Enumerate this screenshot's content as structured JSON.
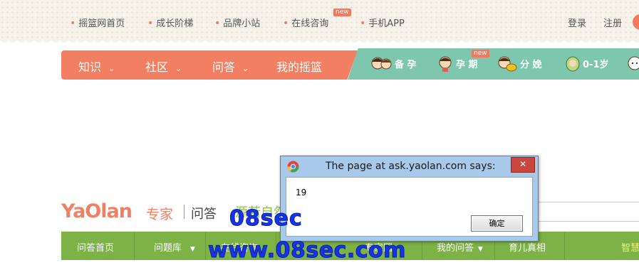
{
  "topbar": {
    "links": [
      {
        "label": "摇篮网首页",
        "name": "home"
      },
      {
        "label": "成长阶梯",
        "name": "growth"
      },
      {
        "label": "品牌小站",
        "name": "brand"
      },
      {
        "label": "在线咨询",
        "name": "consult",
        "badge": "new"
      },
      {
        "label": "手机APP",
        "name": "app"
      }
    ],
    "login": "登录",
    "register": "注册"
  },
  "mainnav": {
    "items": [
      {
        "label": "知识"
      },
      {
        "label": "社区"
      },
      {
        "label": "问答"
      },
      {
        "label": "我的摇篮"
      }
    ],
    "stages": [
      {
        "label": "备 孕"
      },
      {
        "label": "孕 期",
        "badge": "new"
      },
      {
        "label": "分 娩"
      },
      {
        "label": "0-1岁"
      }
    ]
  },
  "header": {
    "logo": "YaOlan",
    "logo_sub": "专家",
    "section": "问答",
    "slogan": "源若自然"
  },
  "subnav": {
    "items": [
      {
        "label": "问答首页"
      },
      {
        "label": "问题库",
        "dropdown": true
      },
      {
        "label": "在线咨询"
      },
      {
        "label": "专家团"
      },
      {
        "label": "我的问答",
        "dropdown": true
      },
      {
        "label": "育儿真相"
      },
      {
        "label": "智慧"
      }
    ]
  },
  "dialog": {
    "title": "The page at ask.yaolan.com says:",
    "message": "19",
    "ok_label": "确定",
    "close_label": "✕"
  },
  "watermark": {
    "line1": "08sec",
    "line2": "www.08sec.com"
  },
  "colors": {
    "orange": "#f37f63",
    "teal": "#7ec6ae",
    "green": "#7db246",
    "watermark": "#1733e6"
  }
}
